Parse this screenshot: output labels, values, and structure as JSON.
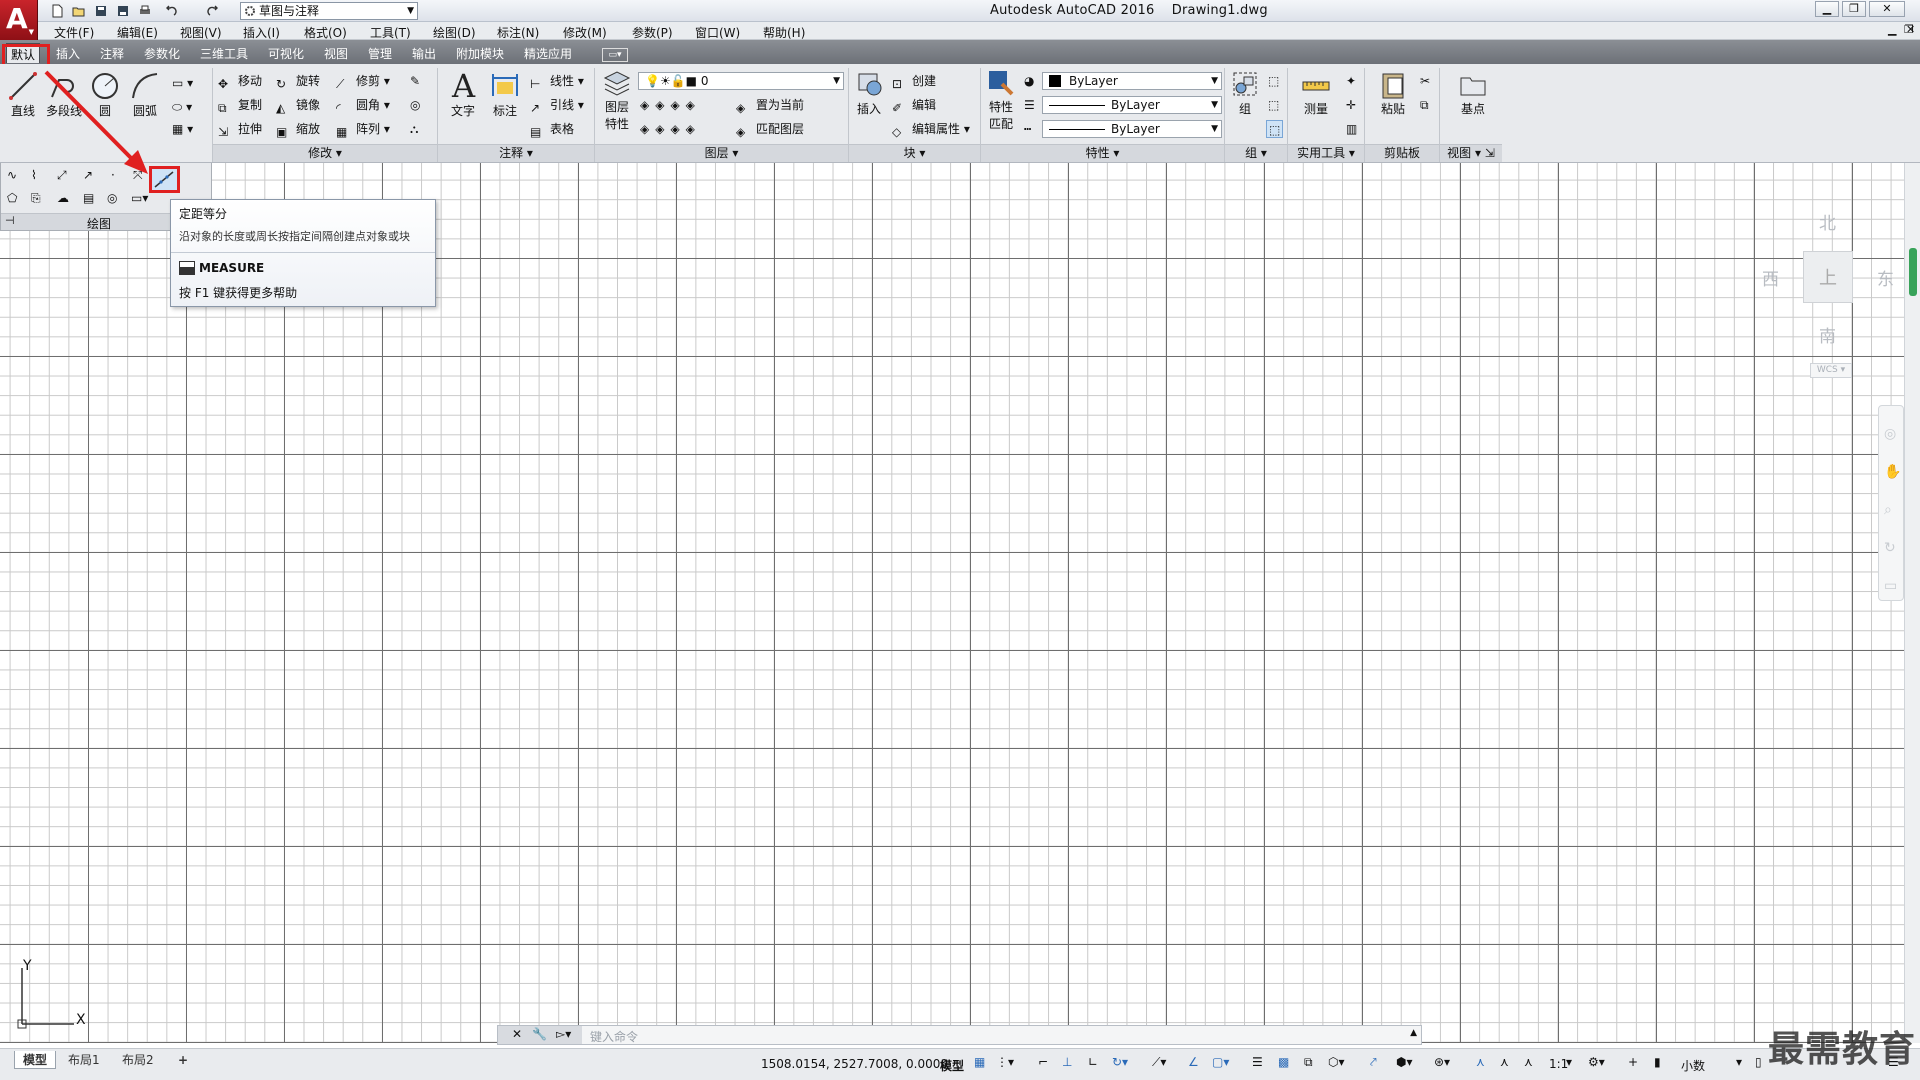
{
  "app": {
    "title": "Autodesk AutoCAD 2016    Drawing1.dwg",
    "logo_letter": "A",
    "workspace": "草图与注释"
  },
  "menu": [
    "文件(F)",
    "编辑(E)",
    "视图(V)",
    "插入(I)",
    "格式(O)",
    "工具(T)",
    "绘图(D)",
    "标注(N)",
    "修改(M)",
    "参数(P)",
    "窗口(W)",
    "帮助(H)"
  ],
  "tabs": [
    "默认",
    "插入",
    "注释",
    "参数化",
    "三维工具",
    "可视化",
    "视图",
    "管理",
    "输出",
    "附加模块",
    "精选应用"
  ],
  "ribbon": {
    "draw": {
      "line": "直线",
      "polyline": "多段线",
      "circle": "圆",
      "arc": "圆弧",
      "title": "绘图"
    },
    "modify": {
      "move": "移动",
      "rotate": "旋转",
      "trim": "修剪",
      "copy": "复制",
      "mirror": "镜像",
      "fillet": "圆角",
      "stretch": "拉伸",
      "scale": "缩放",
      "array": "阵列",
      "title": "修改"
    },
    "annotation": {
      "text": "文字",
      "dimension": "标注",
      "linear": "线性",
      "leader": "引线",
      "table": "表格",
      "title": "注释"
    },
    "layers": {
      "properties_line1": "图层",
      "properties_line2": "特性",
      "current_layer": "0",
      "make_current": "置为当前",
      "match_layer": "匹配图层",
      "title": "图层"
    },
    "block": {
      "insert": "插入",
      "create": "创建",
      "edit": "编辑",
      "edit_attributes": "编辑属性",
      "title": "块"
    },
    "properties": {
      "match_line1": "特性",
      "match_line2": "匹配",
      "color": "ByLayer",
      "linetype": "ByLayer",
      "lineweight": "ByLayer",
      "title": "特性"
    },
    "groups": {
      "group": "组",
      "title": "组"
    },
    "utilities": {
      "measure": "测量",
      "title": "实用工具"
    },
    "clipboard": {
      "paste": "粘贴",
      "title": "剪贴板"
    },
    "view": {
      "base": "基点",
      "title": "视图"
    }
  },
  "tooltip": {
    "title": "定距等分",
    "description": "沿对象的长度或周长按指定间隔创建点对象或块",
    "command": "MEASURE",
    "help": "按 F1 键获得更多帮助"
  },
  "viewcube": {
    "north": "北",
    "south": "南",
    "east": "东",
    "west": "西",
    "top": "上",
    "wcs": "WCS"
  },
  "ucs": {
    "x": "X",
    "y": "Y"
  },
  "command_line": {
    "placeholder": "键入命令"
  },
  "layout_tabs": [
    "模型",
    "布局1",
    "布局2"
  ],
  "status": {
    "coords": "1508.0154, 2527.7008, 0.0000",
    "model": "模型",
    "scale": "1:1",
    "units": "小数"
  },
  "watermark": "最需教育",
  "colors": {
    "logo": "#c9242b",
    "highlight": "#e02020",
    "tab_bar": "#6c7077",
    "ribbon": "#e8eaed"
  }
}
